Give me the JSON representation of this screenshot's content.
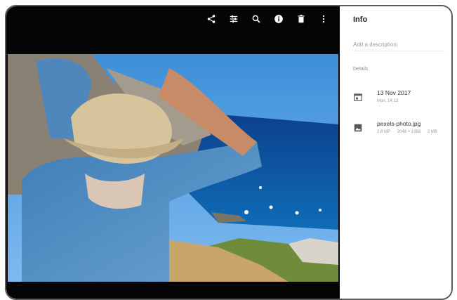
{
  "toolbar": {
    "icons": [
      "share-icon",
      "adjust-icon",
      "zoom-icon",
      "info-icon",
      "delete-icon",
      "more-icon"
    ]
  },
  "info_panel": {
    "title": "Info",
    "description_placeholder": "Add a description",
    "details_label": "Details",
    "date": {
      "icon": "calendar-icon",
      "primary": "13 Nov 2017",
      "secondary": "Mon, 14:13"
    },
    "file": {
      "icon": "image-icon",
      "name": "pexels-photo.jpg",
      "megapixels": "2.8 MP",
      "resolution": "2048 × 1366",
      "size": "2 MB"
    }
  }
}
